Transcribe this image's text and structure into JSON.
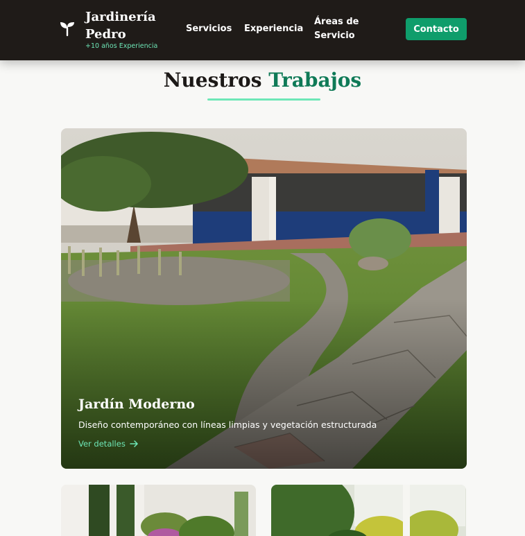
{
  "header": {
    "brand_name": "Jardinería Pedro",
    "brand_tag": "+10 años Experiencia",
    "logo_icon": "sprout-icon",
    "nav": [
      {
        "label": "Servicios"
      },
      {
        "label": "Experiencia"
      },
      {
        "label": "Áreas de Servicio"
      }
    ],
    "contact_label": "Contacto"
  },
  "section": {
    "title_main": "Nuestros",
    "title_accent": "Trabajos"
  },
  "featured": {
    "title": "Jardín Moderno",
    "description": "Diseño contemporáneo con líneas limpias y vegetación estructurada",
    "link_label": "Ver detalles",
    "link_icon": "arrow-right-icon"
  },
  "colors": {
    "header_bg": "#1f1b18",
    "accent": "#0f9d6b",
    "accent_light": "#6ee7b7",
    "title_accent": "#0f7a57"
  }
}
